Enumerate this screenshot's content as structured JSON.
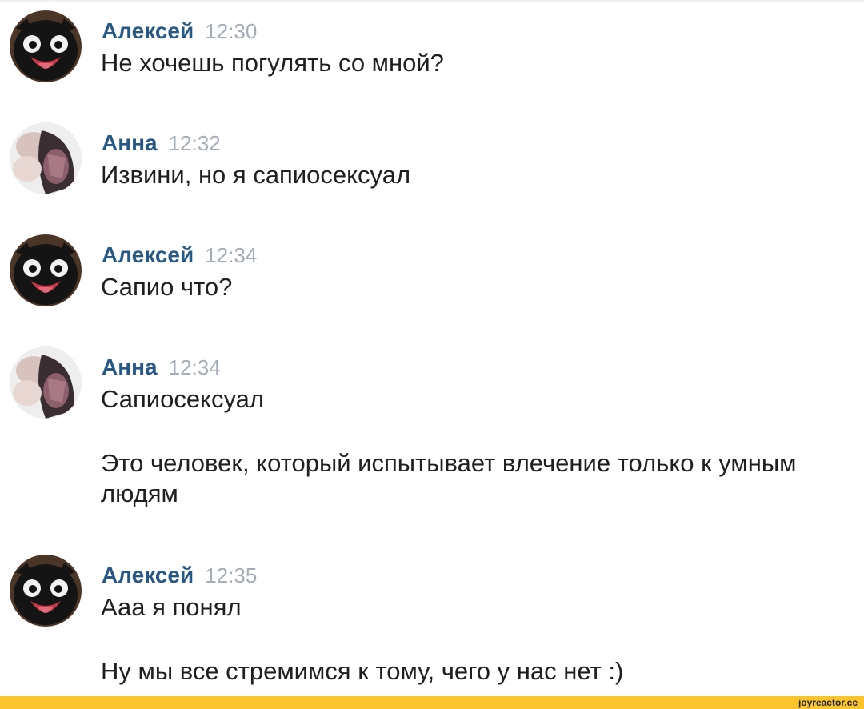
{
  "messages": [
    {
      "author": "Алексей",
      "time": "12:30",
      "avatar": "alexey-avatar",
      "lines": [
        "Не хочешь погулять со мной?"
      ]
    },
    {
      "author": "Анна",
      "time": "12:32",
      "avatar": "anna-avatar",
      "lines": [
        "Извини, но я сапиосексуал"
      ]
    },
    {
      "author": "Алексей",
      "time": "12:34",
      "avatar": "alexey-avatar",
      "lines": [
        "Сапио что?"
      ]
    },
    {
      "author": "Анна",
      "time": "12:34",
      "avatar": "anna-avatar",
      "lines": [
        "Сапиосексуал",
        "Это человек, который испытывает влечение только к умным людям"
      ]
    },
    {
      "author": "Алексей",
      "time": "12:35",
      "avatar": "alexey-avatar",
      "lines": [
        "Ааа я понял",
        "Ну мы все стремимся к тому, чего у нас нет :)"
      ]
    }
  ],
  "footer": {
    "watermark": "joyreactor.cc"
  },
  "colors": {
    "author": "#2a5885",
    "time": "#a3acb7",
    "text": "#1f1f1f",
    "footer_bar": "#fbc42e"
  }
}
